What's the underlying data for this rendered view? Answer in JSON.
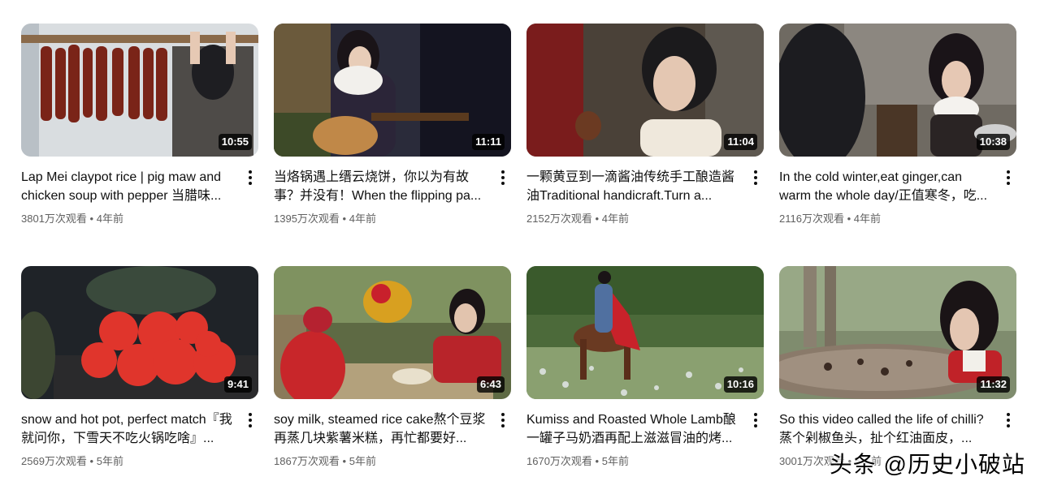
{
  "videos": [
    {
      "title": "Lap Mei claypot rice | pig maw and chicken soup with pepper 当腊味...",
      "views": "3801万次观看",
      "age": "4年前",
      "duration": "10:55"
    },
    {
      "title": "当烙锅遇上缙云烧饼，你以为有故事？并没有！When the flipping pa...",
      "views": "1395万次观看",
      "age": "4年前",
      "duration": "11:11"
    },
    {
      "title": "一颗黄豆到一滴酱油传统手工酿造酱油Traditional handicraft.Turn a...",
      "views": "2152万次观看",
      "age": "4年前",
      "duration": "11:04"
    },
    {
      "title": "In the cold winter,eat ginger,can warm the whole day/正值寒冬，吃...",
      "views": "2116万次观看",
      "age": "4年前",
      "duration": "10:38"
    },
    {
      "title": "snow and hot pot, perfect match『我就问你，下雪天不吃火锅吃啥』...",
      "views": "2569万次观看",
      "age": "5年前",
      "duration": "9:41"
    },
    {
      "title": "soy milk, steamed rice cake熬个豆浆再蒸几块紫薯米糕，再忙都要好...",
      "views": "1867万次观看",
      "age": "5年前",
      "duration": "6:43"
    },
    {
      "title": "Kumiss and Roasted Whole Lamb酿一罐子马奶酒再配上滋滋冒油的烤...",
      "views": "1670万次观看",
      "age": "5年前",
      "duration": "10:16"
    },
    {
      "title": "So this video called the life of chilli?蒸个剁椒鱼头，扯个红油面皮，...",
      "views": "3001万次观看",
      "age": "5年前",
      "duration": "11:32"
    }
  ],
  "separator": "•",
  "watermark": "头条 @历史小破站",
  "icons": {
    "menu": "more-vert-icon"
  }
}
